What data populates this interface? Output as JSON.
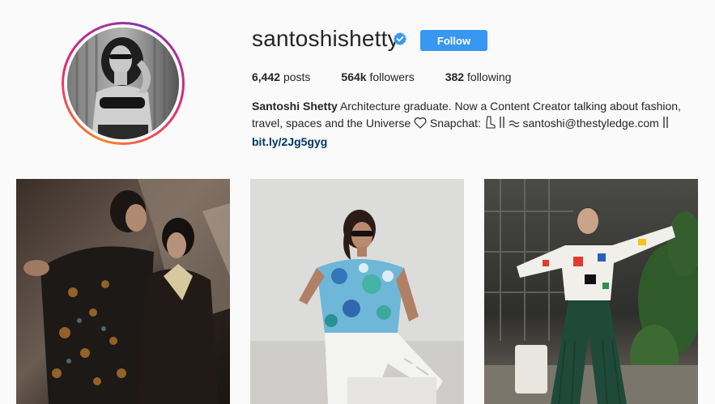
{
  "profile": {
    "username": "santoshishetty",
    "verified": true,
    "follow_label": "Follow",
    "stats": {
      "posts_count": "6,442",
      "posts_label": "posts",
      "followers_count": "564k",
      "followers_label": "followers",
      "following_count": "382",
      "following_label": "following"
    },
    "bio": {
      "full_name": "Santoshi Shetty",
      "text_1": "Architecture graduate. Now a Content Creator talking about fashion, travel, spaces and the Universe",
      "text_2": "Snapchat:",
      "text_3": "santoshi@thestyledge.com",
      "link": "bit.ly/2Jg5gyg"
    }
  },
  "colors": {
    "follow_button": "#3897f0",
    "verified_badge": "#3897f0",
    "link": "#003569",
    "ring_gradient": [
      "#f58529",
      "#dd2a7b",
      "#8134af"
    ]
  },
  "posts": [
    {
      "subject": "couple in dark patterned jackets, warm shadows"
    },
    {
      "subject": "woman in tie-dye tee and white ripped jeans against white wall"
    },
    {
      "subject": "woman in colorful blocked sweater and green flared pants in courtyard"
    }
  ]
}
